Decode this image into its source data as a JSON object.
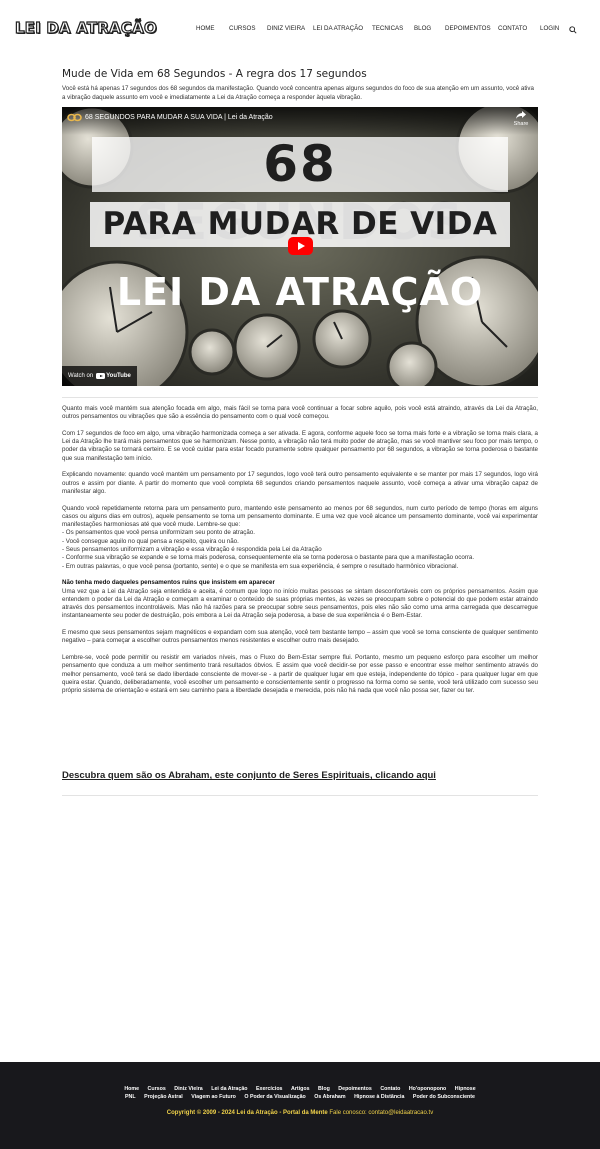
{
  "header": {
    "logo": "LEI DA ATRAÇÃO",
    "nav": [
      "HOME",
      "CURSOS",
      "DINIZ VIEIRA",
      "LEI DA ATRAÇÃO",
      "TECNICAS",
      "BLOG",
      "DEPOIMENTOS",
      "CONTATO",
      "LOGIN"
    ],
    "search_icon": "search-icon"
  },
  "article": {
    "title": "Mude de Vida em 68 Segundos - A regra dos 17 segundos",
    "intro": "Você está há apenas 17 segundos dos 68 segundos da manifestação. Quando você concentra apenas alguns segundos do foco de sua atenção em um assunto, você ativa a vibração daquele assunto em você e imediatamente a Lei da Atração começa a responder àquela vibração.",
    "video": {
      "title": "68 SEGUNDOS PARA MUDAR A SUA VIDA | Lei da Atração",
      "share": "Share",
      "thumb_line1": "68 SEGUNDOS",
      "thumb_line2": "PARA MUDAR DE VIDA",
      "thumb_line3": "LEI DA ATRAÇÃO",
      "watch_on": "Watch on",
      "youtube": "YouTube"
    },
    "p1": "Quanto mais você mantém sua atenção focada em algo, mais fácil se torna para você continuar a focar sobre aquilo, pois você está atraindo, através da Lei da Atração, outros pensamentos ou vibrações que são a essência do pensamento com o qual você começou.",
    "p2": "Com 17 segundos de foco em algo, uma vibração harmonizada começa a ser ativada. E agora, conforme aquele foco se torna mais forte e a vibração se torna mais clara, a Lei da Atração lhe trará mais pensamentos que se harmonizam. Nesse ponto, a vibração não terá muito poder de atração, mas se você mantiver seu foco por mais tempo, o poder da vibração se tornará certeiro. E se você cuidar para estar focado puramente sobre qualquer pensamento por 68 segundos, a vibração se torna poderosa o bastante que sua manifestação tem início.",
    "p3": "Explicando novamente: quando você mantém um pensamento por 17 segundos, logo você terá outro pensamento equivalente e se manter por mais 17 segundos, logo virá outros e assim por diante. A partir do momento que você completa 68 segundos criando pensamentos naquele assunto, você começa a ativar uma vibração capaz de manifestar algo.",
    "p4": "Quando você repetidamente retorna para um pensamento puro, mantendo este pensamento ao menos por 68 segundos, num curto período de tempo (horas em alguns casos ou alguns dias em outros), aquele pensamento se torna um pensamento dominante. E uma vez que você alcance um pensamento dominante, você vai experimentar manifestações harmoniosas até que você mude. Lembre-se que:",
    "list": [
      "- Os pensamentos que você pensa uniformizam seu ponto de atração.",
      "- Você consegue aquilo no qual pensa a respeito, queira ou não.",
      "- Seus pensamentos uniformizam a vibração e essa vibração é respondida pela Lei da Atração",
      "- Conforme sua vibração se expande e se torna mais poderosa, consequentemente ela se torna poderosa o bastante para que a manifestação ocorra.",
      "- Em outras palavras, o que você pensa (portanto, sente) e o que se manifesta em sua experiência, é sempre o resultado harmônico vibracional."
    ],
    "subheading": "Não tenha medo daqueles pensamentos ruins que insistem em aparecer",
    "p5": "Uma vez que a Lei da Atração seja entendida e aceita, é comum que logo no início muitas pessoas se sintam desconfortáveis com os próprios pensamentos. Assim que entendem o poder da Lei da Atração e começam a examinar o conteúdo de suas próprias mentes, às vezes se preocupam sobre o potencial do que podem estar atraindo através dos pensamentos incontroláveis. Mas não há razões para se preocupar sobre seus pensamentos, pois eles não são como uma arma carregada que descarregue instantaneamente seu poder de destruição, pois embora a Lei da Atração seja poderosa, a base de sua experiência é o Bem-Estar.",
    "p6": "E mesmo que seus pensamentos sejam magnéticos e expandam com sua atenção, você tem bastante tempo – assim que você se torna consciente de qualquer sentimento negativo – para começar a escolher outros pensamentos menos resistentes e escolher outro mais desejado.",
    "p7": "Lembre-se, você pode permitir ou resistir em variados níveis, mas o Fluxo do Bem-Estar sempre flui. Portanto, mesmo um pequeno esforço para escolher um melhor pensamento que conduza a um melhor sentimento trará resultados óbvios. E assim que você decidir-se por esse passo e encontrar esse melhor sentimento através do melhor pensamento, você terá se dado liberdade consciente de mover-se - a partir de qualquer lugar em que esteja, independente do tópico - para qualquer lugar em que queira estar. Quando, deliberadamente, você escolher um pensamento e conscientemente sentir o progresso na forma como se sente, você terá utilizado com sucesso seu próprio sistema de orientação e estará em seu caminho para a liberdade desejada e merecida, pois não há nada que você não possa ser, fazer ou ter.",
    "abraham_link": "Descubra quem são os Abraham, este conjunto de Seres Espirituais, clicando aqui"
  },
  "footer": {
    "row1": [
      "Home",
      "Cursos",
      "Diniz Vieira",
      "Lei da Atração",
      "Exercícios",
      "Artigos",
      "Blog",
      "Depoimentos",
      "Contato",
      "Ho'oponopono",
      "Hipnose"
    ],
    "row2": [
      "PNL",
      "Projeção Astral",
      "Viagem ao Futuro",
      "O Poder da Visualização",
      "Os Abraham",
      "Hipnose à Distância",
      "Poder do Subconsciente"
    ],
    "copyright": "Copyright © 2009 - 2024 Lei da Atração - Portal da Mente",
    "contact": "Fale conosco: contato@leidaatracao.tv"
  },
  "colors": {
    "footer_bg": "#18181c",
    "copyright": "#f0d24a",
    "play": "#ff0000"
  }
}
